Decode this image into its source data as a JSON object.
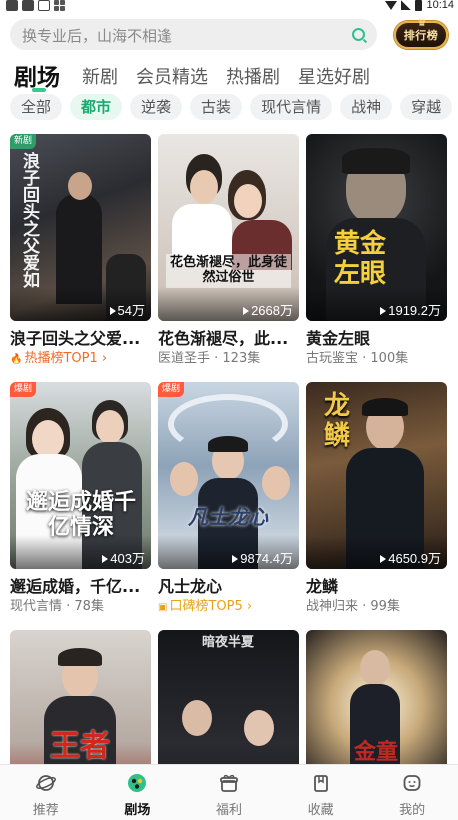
{
  "status_bar": {
    "time": "10:14"
  },
  "search": {
    "placeholder": "换专业后，山海不相逢",
    "rank_label": "排行榜"
  },
  "main_tabs": [
    {
      "label": "剧场",
      "active": true
    },
    {
      "label": "新剧"
    },
    {
      "label": "会员精选"
    },
    {
      "label": "热播剧"
    },
    {
      "label": "星选好剧"
    }
  ],
  "sub_tabs": [
    {
      "label": "全部"
    },
    {
      "label": "都市",
      "active": true
    },
    {
      "label": "逆袭"
    },
    {
      "label": "古装"
    },
    {
      "label": "现代言情"
    },
    {
      "label": "战神"
    },
    {
      "label": "穿越"
    }
  ],
  "cards": [
    {
      "title": "浪子回头之父爱...",
      "views": "54万",
      "tag": "新剧",
      "sub": "热播榜TOP1",
      "sub_icon": "fire-icon",
      "poster_text": "浪子回头之父爱如"
    },
    {
      "title": "花色渐褪尽，此...",
      "views": "2668万",
      "sub": "医道圣手 · 123集",
      "poster_text": "花色渐褪尽，此身徒然过俗世"
    },
    {
      "title": "黄金左眼",
      "views": "1919.2万",
      "sub": "古玩鉴宝 · 100集",
      "poster_text": "黄金左眼"
    },
    {
      "title": "邂逅成婚，千亿...",
      "views": "403万",
      "tag": "爆剧",
      "sub": "现代言情 · 78集",
      "poster_text": "邂逅成婚千亿情深"
    },
    {
      "title": "凡士龙心",
      "views": "9874.4万",
      "tag": "爆剧",
      "sub": "口碑榜TOP5",
      "sub_icon": "praise-icon",
      "poster_text": "凡士龙心"
    },
    {
      "title": "龙鳞",
      "views": "4650.9万",
      "sub": "战神归来 · 99集",
      "poster_text": "龙鳞"
    },
    {
      "title": "",
      "views": "",
      "sub": "",
      "poster_text": "王者"
    },
    {
      "title": "",
      "views": "",
      "sub": "",
      "poster_text": "暗夜半夏"
    },
    {
      "title": "",
      "views": "",
      "sub": "",
      "poster_text": "金童"
    }
  ],
  "bottom_nav": [
    {
      "label": "推荐",
      "icon": "planet-icon"
    },
    {
      "label": "剧场",
      "icon": "theater-icon",
      "active": true
    },
    {
      "label": "福利",
      "icon": "gift-icon"
    },
    {
      "label": "收藏",
      "icon": "bookmark-icon"
    },
    {
      "label": "我的",
      "icon": "profile-icon"
    }
  ],
  "colors": {
    "accent": "#36c98e",
    "rank_orange": "#f06a2a",
    "praise_gold": "#e8a21a"
  }
}
